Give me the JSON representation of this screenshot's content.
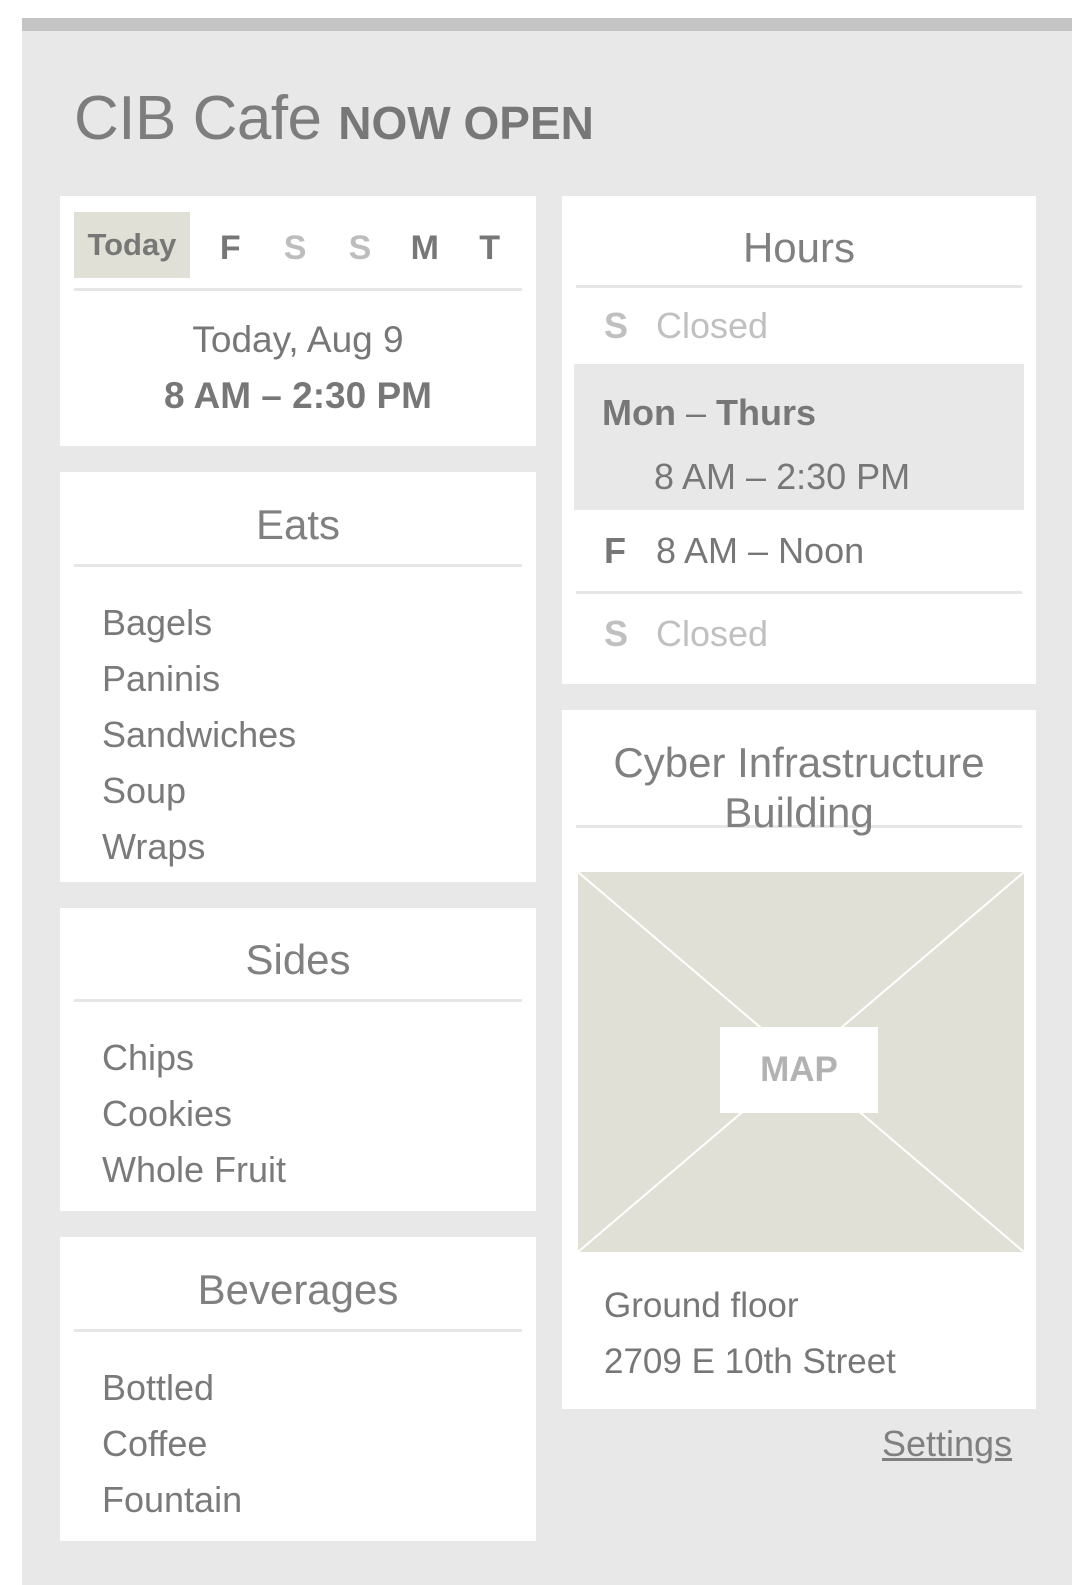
{
  "header": {
    "name": "CIB Cafe",
    "status": "NOW OPEN"
  },
  "day_picker": {
    "today_label": "Today",
    "days": [
      {
        "label": "F",
        "dim": false
      },
      {
        "label": "S",
        "dim": true
      },
      {
        "label": "S",
        "dim": true
      },
      {
        "label": "M",
        "dim": false
      },
      {
        "label": "T",
        "dim": false
      }
    ],
    "date": "Today, Aug 9",
    "hours": "8 AM – 2:30 PM"
  },
  "eats": {
    "title": "Eats",
    "items": [
      "Bagels",
      "Paninis",
      "Sandwiches",
      "Soup",
      "Wraps"
    ]
  },
  "sides": {
    "title": "Sides",
    "items": [
      "Chips",
      "Cookies",
      "Whole Fruit"
    ]
  },
  "beverages": {
    "title": "Beverages",
    "items": [
      "Bottled",
      "Coffee",
      "Fountain"
    ]
  },
  "hours": {
    "title": "Hours",
    "rows": [
      {
        "day": "S",
        "time": "Closed"
      },
      {
        "day_start": "Mon",
        "dash": "–",
        "day_end": "Thurs",
        "time": "8 AM – 2:30 PM"
      },
      {
        "day": "F",
        "time": "8 AM – Noon"
      },
      {
        "day": "S",
        "time": "Closed"
      }
    ]
  },
  "location": {
    "title": "Cyber Infrastructure Building",
    "map_label": "MAP",
    "floor": "Ground floor",
    "street": "2709 E 10th Street"
  },
  "footer": {
    "settings": "Settings"
  },
  "colors": {
    "background": "#e8e8e8",
    "card": "#ffffff",
    "highlight": "#e0e0d6",
    "text": "#777777"
  }
}
